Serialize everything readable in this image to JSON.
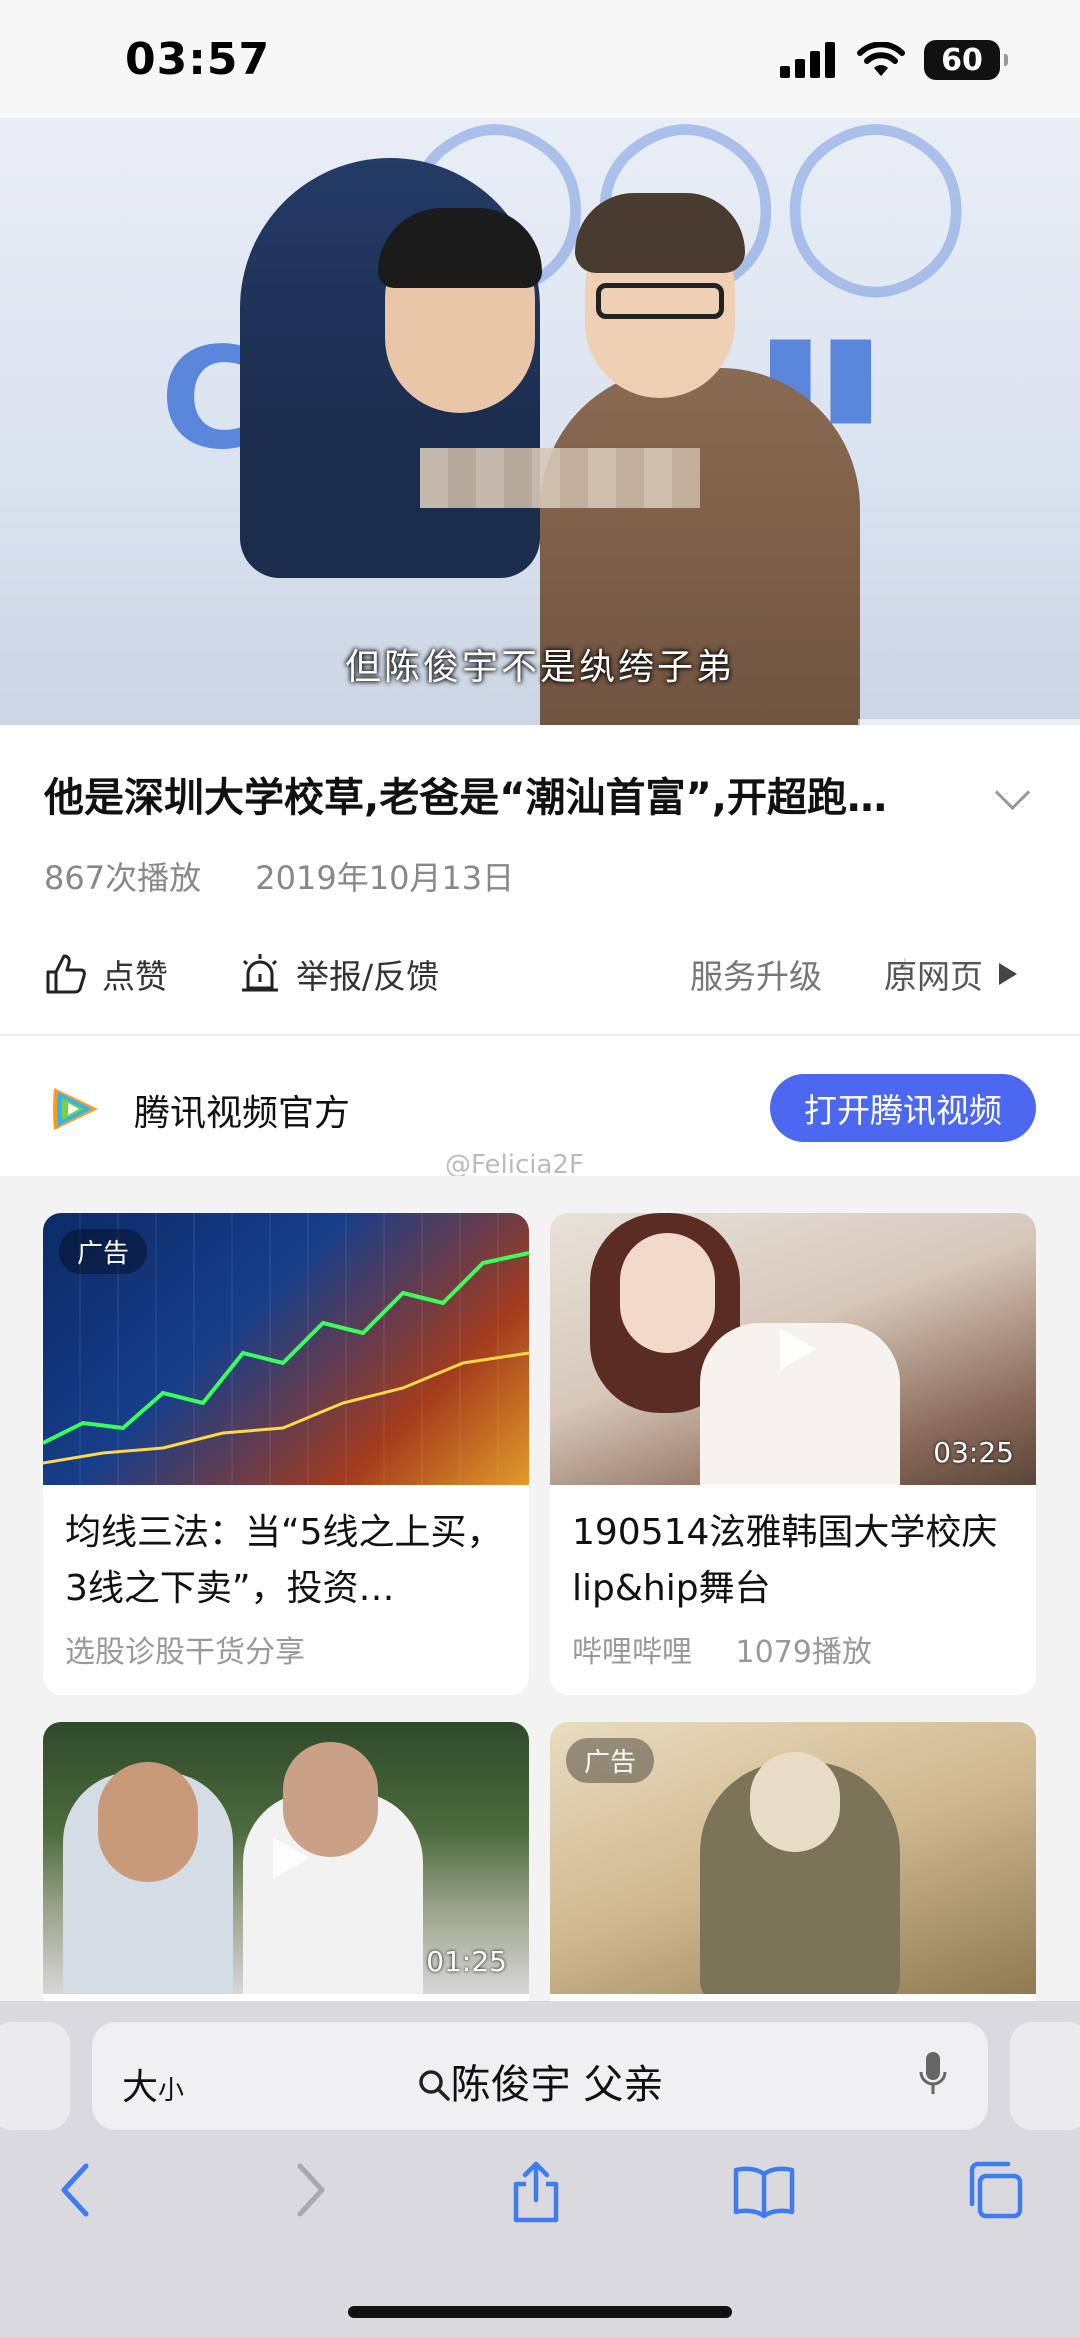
{
  "status_bar": {
    "time": "03:57",
    "battery": "60"
  },
  "hero": {
    "subtitle": "但陈俊宇不是纨绔子弟"
  },
  "video": {
    "title": "他是深圳大学校草,老爸是“潮汕首富”,开超跑…",
    "plays": "867次播放",
    "date": "2019年10月13日"
  },
  "actions": {
    "like": "点赞",
    "report": "举报/反馈",
    "upgrade": "服务升级",
    "original": "原网页"
  },
  "channel": {
    "name": "腾讯视频官方",
    "open_button": "打开腾讯视频"
  },
  "watermark": "@Felicia2F",
  "cards": [
    {
      "badge": "广告",
      "title": "均线三法：当“5线之上买，3线之下卖”，投资…",
      "source": "选股诊股干货分享",
      "views": ""
    },
    {
      "duration": "03:25",
      "title": "190514泫雅韩国大学校庆lip&hip舞台",
      "source": "哔哩哔哩",
      "views": "1079播放"
    },
    {
      "duration": "01:25"
    },
    {
      "badge": "广告"
    }
  ],
  "browser": {
    "text_size": "大",
    "text_size_small": "小",
    "search_query": "陈俊宇 父亲"
  },
  "icons": [
    "signal-icon",
    "wifi-icon",
    "battery-icon",
    "like-icon",
    "report-icon",
    "play-triangle-icon",
    "tencent-video-logo",
    "search-icon",
    "mic-icon",
    "back-icon",
    "forward-icon",
    "share-icon",
    "bookmarks-icon",
    "tabs-icon"
  ]
}
